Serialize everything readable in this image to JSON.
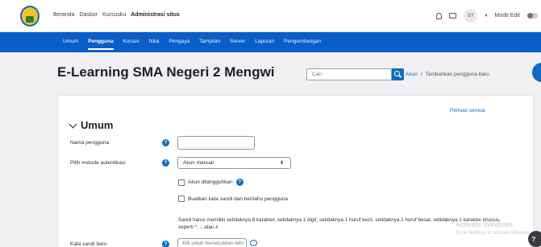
{
  "topnav": {
    "items": [
      "Beranda",
      "Dasbor",
      "Kursusku",
      "Administrasi situs"
    ],
    "active_index": 3,
    "avatar_initials": "SY",
    "mode_edit_label": "Mode Edit"
  },
  "bluenav": {
    "items": [
      "Umum",
      "Pengguna",
      "Kursus",
      "Nilai",
      "Pengaya",
      "Tampilan",
      "Server",
      "Laporan",
      "Pengembangan"
    ],
    "active_index": 1
  },
  "page": {
    "title": "E-Learning SMA Negeri 2 Mengwi"
  },
  "search": {
    "placeholder": "Cari"
  },
  "breadcrumb": {
    "items": [
      "Akun",
      "Tambahkan pengguna baru"
    ],
    "separator": "/"
  },
  "form": {
    "expand_all": "Perluas semua",
    "section_title": "Umum",
    "username_label": "Nama pengguna",
    "username_value": "",
    "auth_label": "Pilih metode autentikasi",
    "auth_value": "Akun manual",
    "suspended_label": "Akun ditangguhkan",
    "generate_password_label": "Buatkan kata sandi dan beritahu pengguna",
    "password_rules": "Sandi harus memiliki setidaknya 8 karakter, setidaknya 1 digit, setidaknya 1 huruf kecil, setidaknya 1 huruf besar, setidaknya 1 karakter khusus, seperti *, -, atau #",
    "password_label": "Kata sandi baru",
    "password_placeholder": "Klik untuk memasukkan teks"
  },
  "watermark": {
    "line1": "Activate Windows",
    "line2": "Go to Settings to activate Windows."
  },
  "help_float": "?",
  "help_glyph": "?",
  "colors": {
    "primary": "#0f6cbf",
    "navbar_blue": "#0a5ec7",
    "background": "#f0f0f3"
  },
  "icons": {
    "logo": "school-logo-icon",
    "notifications": "bell-icon",
    "messages": "chat-icon",
    "search": "search-icon",
    "help": "question-circle-icon",
    "reveal": "eye-icon",
    "pencil": "pencil-icon"
  }
}
